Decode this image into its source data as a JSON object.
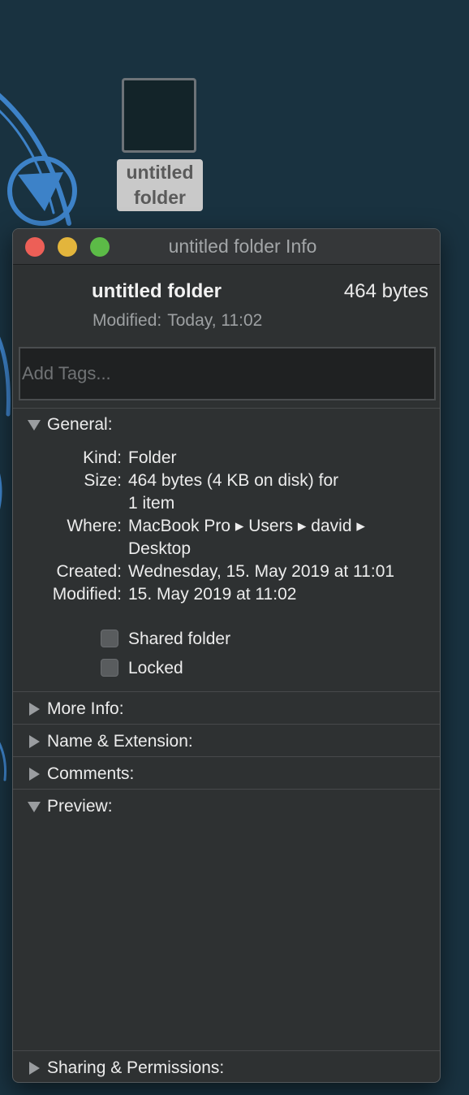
{
  "desktop": {
    "folder_label_line1": "untitled",
    "folder_label_line2": "folder"
  },
  "window": {
    "title": "untitled folder Info"
  },
  "header": {
    "name": "untitled folder",
    "size": "464 bytes",
    "modified_label": "Modified:",
    "modified_value": "Today, 11:02"
  },
  "tags": {
    "placeholder": "Add Tags..."
  },
  "sections": {
    "general": "General:",
    "more_info": "More Info:",
    "name_extension": "Name & Extension:",
    "comments": "Comments:",
    "preview": "Preview:",
    "sharing_permissions": "Sharing & Permissions:"
  },
  "general": {
    "kind_label": "Kind:",
    "kind_value": "Folder",
    "size_label": "Size:",
    "size_value_line1": "464 bytes (4 KB on disk) for",
    "size_value_line2": "1 item",
    "where_label": "Where:",
    "where_value_line1": "MacBook Pro ▸ Users ▸ david ▸",
    "where_value_line2": "Desktop",
    "created_label": "Created:",
    "created_value": "Wednesday, 15. May 2019 at 11:01",
    "modified_label": "Modified:",
    "modified_value": "15. May 2019 at 11:02"
  },
  "checkboxes": {
    "shared_folder": {
      "label": "Shared folder",
      "checked": false
    },
    "locked": {
      "label": "Locked",
      "checked": false
    }
  },
  "colors": {
    "desktop_background": "#193240",
    "desktop_art_accent": "#3d82c8",
    "window_background": "#2e3132",
    "close": "#ed5f57",
    "minimize": "#e3b53c",
    "zoom": "#5cbb47"
  }
}
